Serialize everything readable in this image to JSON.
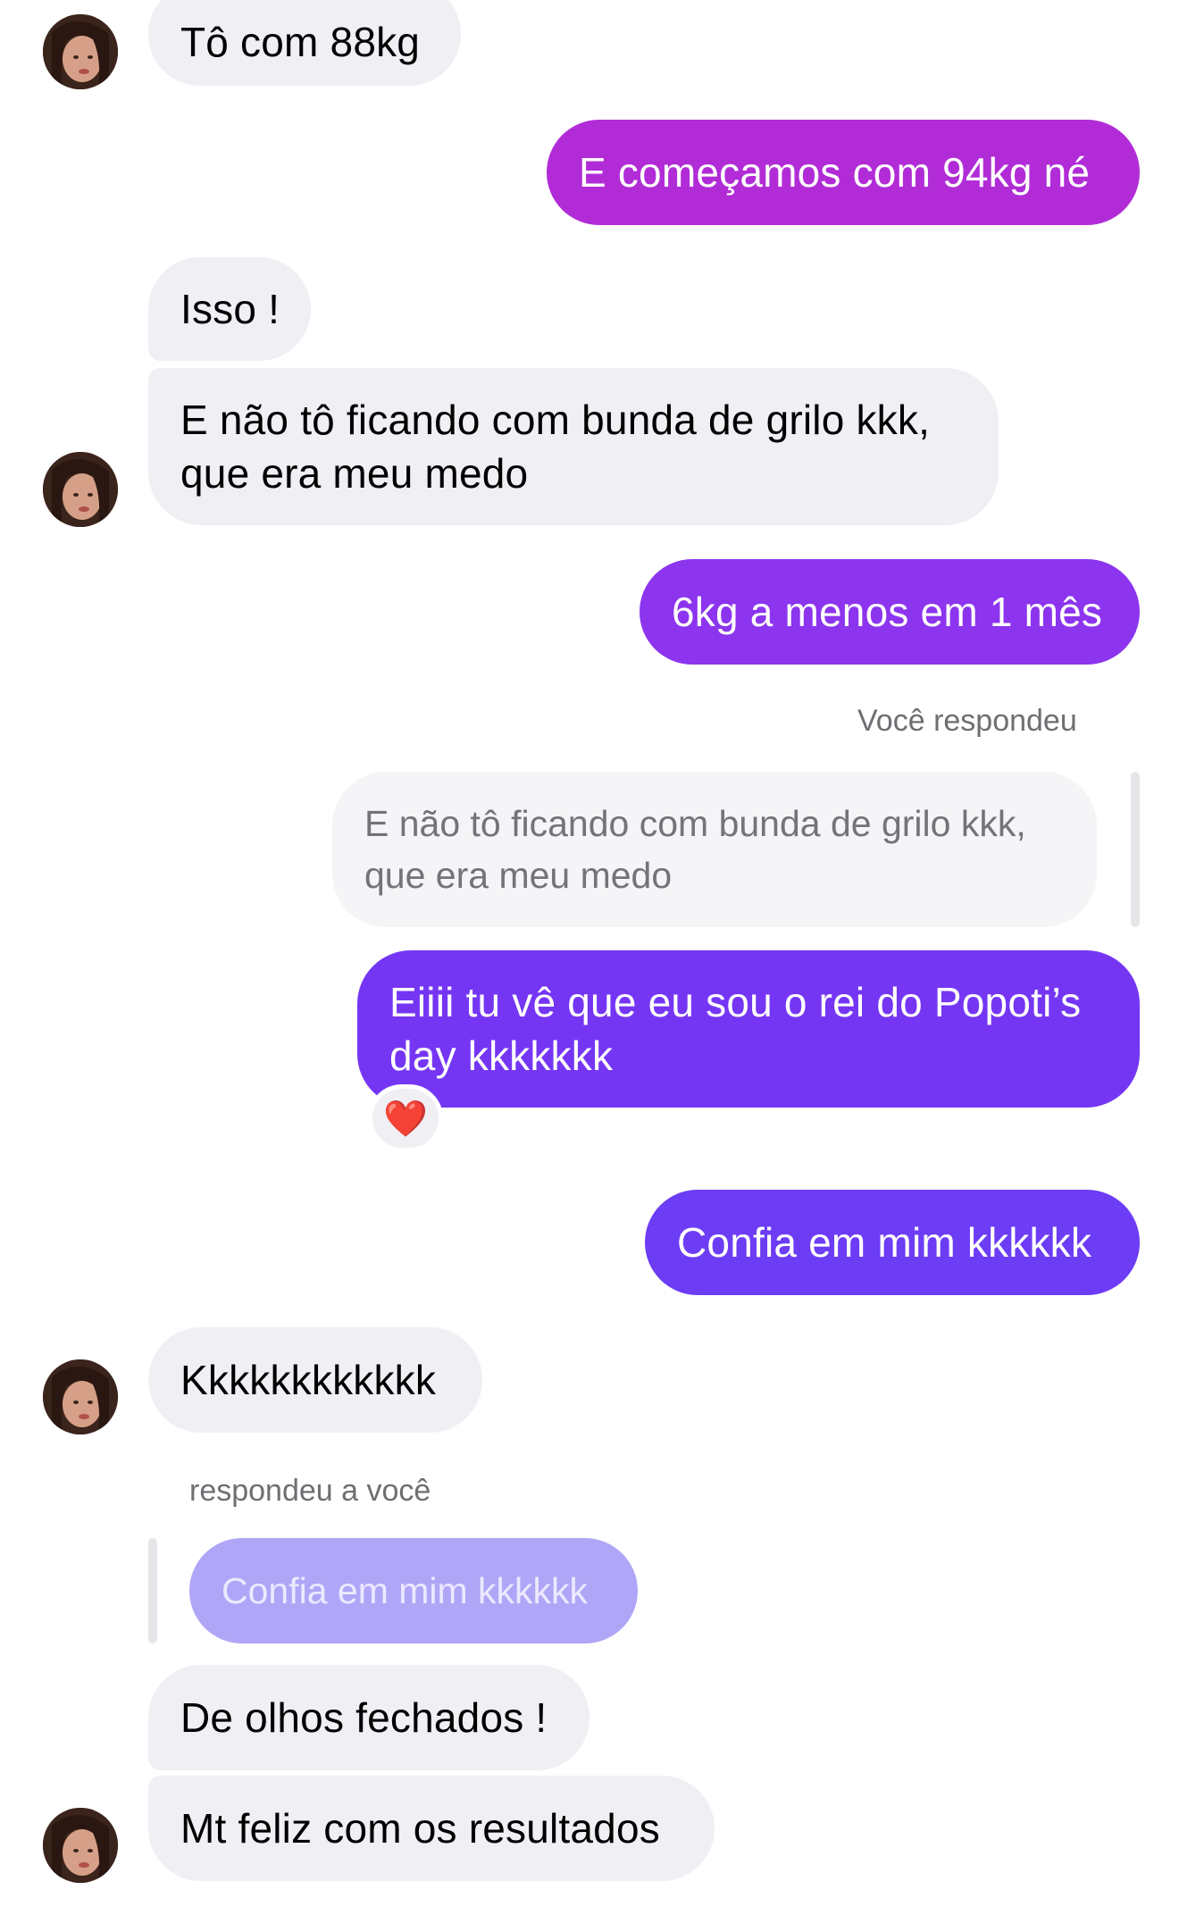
{
  "messages": {
    "m1": "Tô com 88kg",
    "m2": "E começamos com 94kg né",
    "m3": "Isso !",
    "m4_line1": "E não tô ficando com bunda de grilo kkk,",
    "m4_line2": "que era meu medo",
    "m5": "6kg a menos em 1 mês",
    "m6_line1": "Eiiii tu vê que eu sou o rei do Popoti’s",
    "m6_line2": "day kkkkkkk",
    "m7": "Confia em mim kkkkkk",
    "m8": "Kkkkkkkkkkkk",
    "m9": "De olhos fechados !",
    "m10": "Mt feliz com os resultados"
  },
  "replies": {
    "you_replied_label": "Você respondeu",
    "quoted_in_line1": "E não tô ficando com bunda de grilo kkk,",
    "quoted_in_line2": "que era meu medo",
    "replied_to_you_label": "respondeu a você",
    "quoted_out": "Confia em mim kkkkkk"
  },
  "reaction": {
    "emoji": "❤️"
  },
  "colors": {
    "outgoing_gradient_top": "#b32bd8",
    "outgoing_gradient_mid": "#8a33ef",
    "outgoing_gradient_bottom": "#6c3cf6",
    "incoming": "#efeff4"
  }
}
